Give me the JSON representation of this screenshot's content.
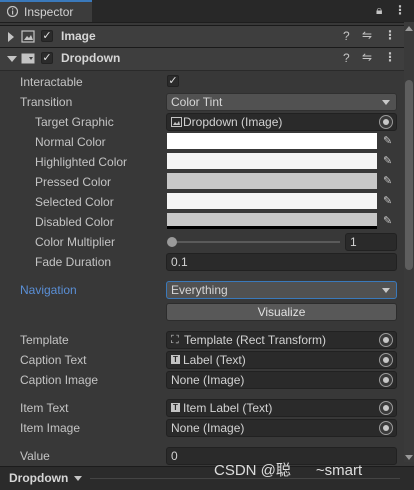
{
  "tab": {
    "title": "Inspector"
  },
  "components": {
    "image": {
      "name": "Image"
    },
    "dropdown": {
      "name": "Dropdown"
    }
  },
  "props": {
    "interactable": {
      "label": "Interactable",
      "checked": "✓"
    },
    "transition": {
      "label": "Transition",
      "value": "Color Tint"
    },
    "target_graphic": {
      "label": "Target Graphic",
      "value": "Dropdown (Image)"
    },
    "normal_color": {
      "label": "Normal Color",
      "color": "#ffffff"
    },
    "highlighted_color": {
      "label": "Highlighted Color",
      "color": "#f5f5f5"
    },
    "pressed_color": {
      "label": "Pressed Color",
      "color": "#c8c8c8"
    },
    "selected_color": {
      "label": "Selected Color",
      "color": "#f5f5f5"
    },
    "disabled_color": {
      "label": "Disabled Color",
      "color": "#c8c8c8"
    },
    "color_multiplier": {
      "label": "Color Multiplier",
      "value": "1",
      "slider_fraction": 0.0
    },
    "fade_duration": {
      "label": "Fade Duration",
      "value": "0.1"
    },
    "navigation": {
      "label": "Navigation",
      "value": "Everything",
      "visualize": "Visualize"
    },
    "template": {
      "label": "Template",
      "value": "Template (Rect Transform)"
    },
    "caption_text": {
      "label": "Caption Text",
      "value": "Label (Text)"
    },
    "caption_image": {
      "label": "Caption Image",
      "value": "None (Image)"
    },
    "item_text": {
      "label": "Item Text",
      "value": "Item Label (Text)"
    },
    "item_image": {
      "label": "Item Image",
      "value": "None (Image)"
    },
    "value": {
      "label": "Value",
      "value": "0"
    }
  },
  "footer": {
    "label": "Dropdown"
  },
  "watermark": {
    "text": "CSDN @聪      ~smart"
  },
  "colors": {
    "accent": "#3a79bb",
    "navigation_label": "#5a8fd6"
  }
}
